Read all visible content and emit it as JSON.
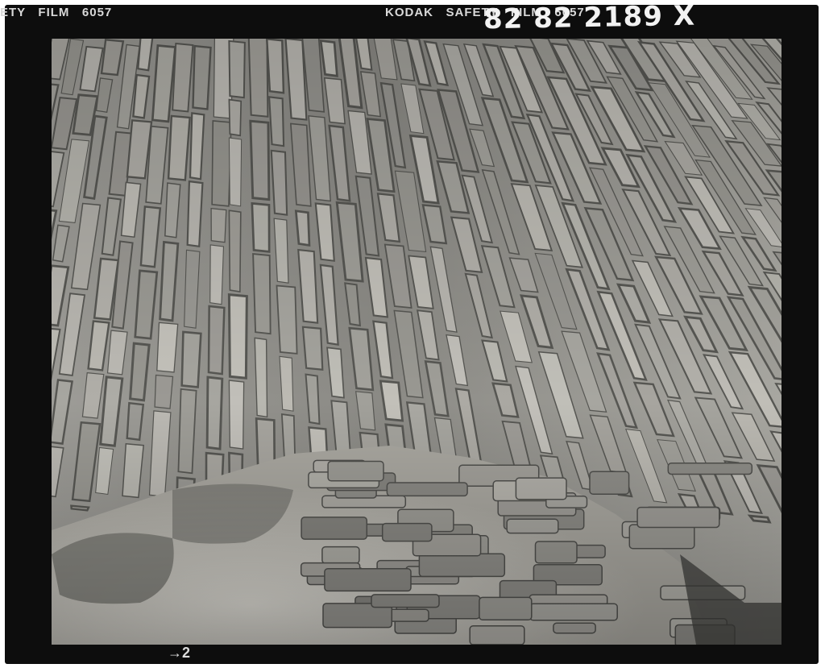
{
  "film_edge": {
    "left_text": "ETY   FILM   6057",
    "right_text": "KODAK   SAFETY   FILM   6057",
    "handwritten_number": "82 82 2189 X",
    "frame_marker": "→2"
  },
  "photo": {
    "icon": "stone-chamber-photo-icon",
    "tone": "black-and-white"
  },
  "colors": {
    "film_base": "#0d0d0d",
    "edge_print": "#d9d9d9",
    "stone_light": "#c9c7c0",
    "stone_dark": "#4a4a47"
  }
}
